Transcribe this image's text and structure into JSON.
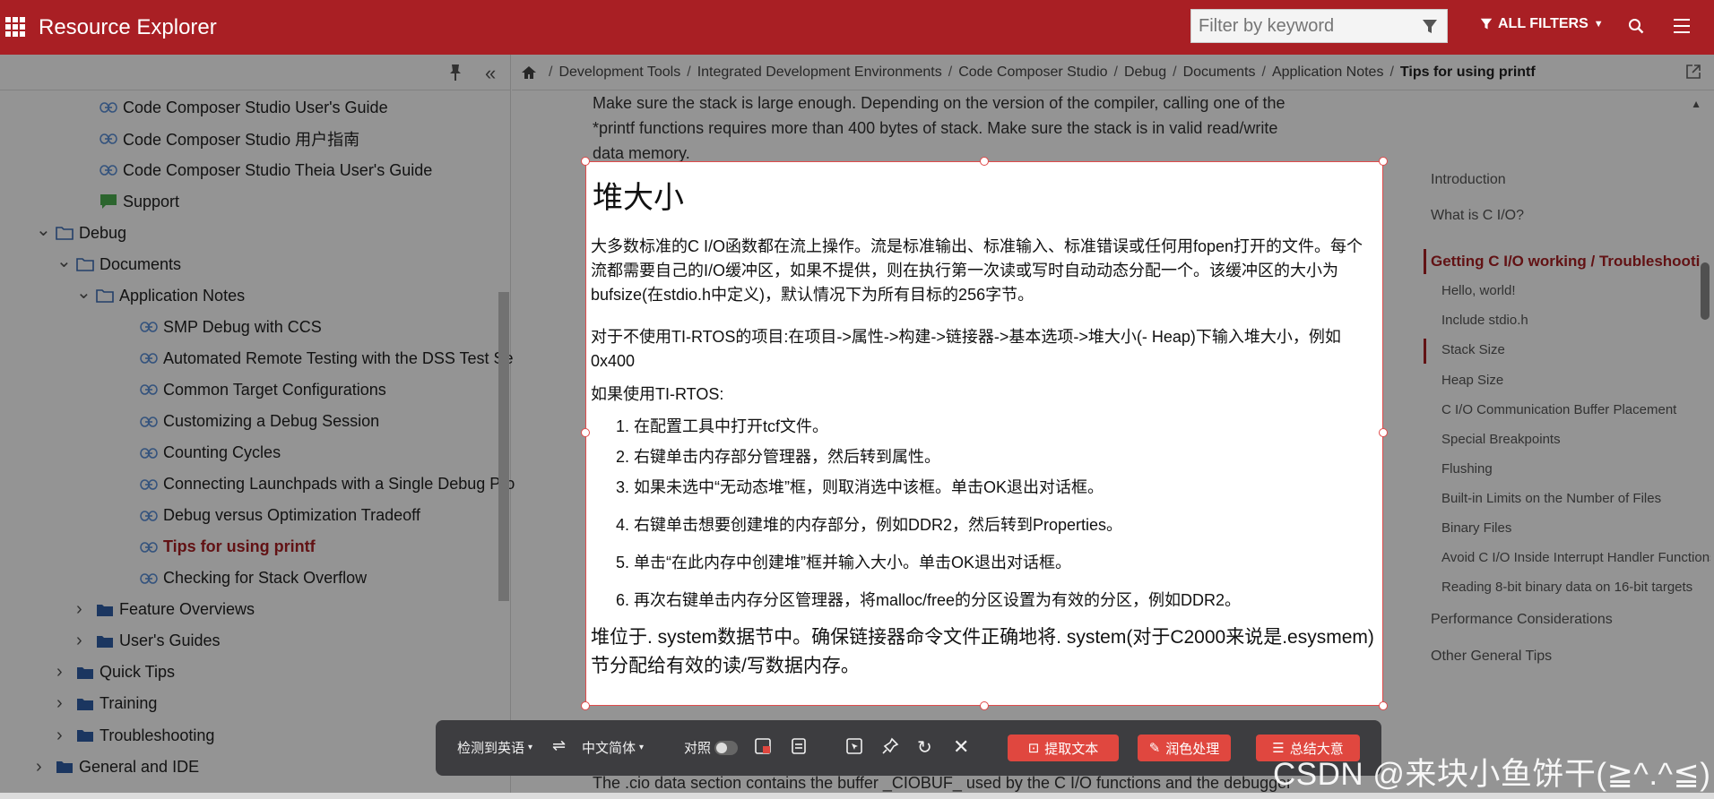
{
  "app": {
    "title": "Resource Explorer",
    "filter_placeholder": "Filter by keyword",
    "all_filters_label": "ALL FILTERS",
    "brand_color": "#a91f24"
  },
  "sidebar": {
    "items": [
      {
        "label": "Code Composer Studio User's Guide",
        "icon": "link-icon",
        "depth": 2
      },
      {
        "label": "Code Composer Studio 用户指南",
        "icon": "link-icon",
        "depth": 2
      },
      {
        "label": "Code Composer Studio Theia User's Guide",
        "icon": "link-icon",
        "depth": 2
      },
      {
        "label": "Support",
        "icon": "chat-icon",
        "depth": 2
      },
      {
        "label": "Debug",
        "icon": "folder-open-icon",
        "depth": 1,
        "expanded": true
      },
      {
        "label": "Documents",
        "icon": "folder-open-icon",
        "depth": 2,
        "expanded": true
      },
      {
        "label": "Application Notes",
        "icon": "folder-open-icon",
        "depth": 3,
        "expanded": true
      },
      {
        "label": "SMP Debug with CCS",
        "icon": "link-icon",
        "depth": 4
      },
      {
        "label": "Automated Remote Testing with the DSS Test Se",
        "icon": "link-icon",
        "depth": 4
      },
      {
        "label": "Common Target Configurations",
        "icon": "link-icon",
        "depth": 4
      },
      {
        "label": "Customizing a Debug Session",
        "icon": "link-icon",
        "depth": 4
      },
      {
        "label": "Counting Cycles",
        "icon": "link-icon",
        "depth": 4
      },
      {
        "label": "Connecting Launchpads with a Single Debug Pro",
        "icon": "link-icon",
        "depth": 4
      },
      {
        "label": "Debug versus Optimization Tradeoff",
        "icon": "link-icon",
        "depth": 4
      },
      {
        "label": "Tips for using printf",
        "icon": "link-icon",
        "depth": 4,
        "active": true
      },
      {
        "label": "Checking for Stack Overflow",
        "icon": "link-icon",
        "depth": 4
      },
      {
        "label": "Feature Overviews",
        "icon": "folder-icon",
        "depth": 3,
        "expanded": false
      },
      {
        "label": "User's Guides",
        "icon": "folder-icon",
        "depth": 3,
        "expanded": false
      },
      {
        "label": "Quick Tips",
        "icon": "folder-icon",
        "depth": 2,
        "expanded": false
      },
      {
        "label": "Training",
        "icon": "folder-icon",
        "depth": 2,
        "expanded": false
      },
      {
        "label": "Troubleshooting",
        "icon": "folder-icon",
        "depth": 2,
        "expanded": false
      },
      {
        "label": "General and IDE",
        "icon": "folder-icon",
        "depth": 1,
        "expanded": false
      }
    ]
  },
  "breadcrumb": {
    "items": [
      "Development Tools",
      "Integrated Development Environments",
      "Code Composer Studio",
      "Debug",
      "Documents",
      "Application Notes"
    ],
    "current": "Tips for using printf"
  },
  "content": {
    "paragraph": "Make sure the stack is large enough. Depending on the version of the compiler, calling one of the *printf functions requires more than 400 bytes of stack. Make sure the stack is in valid read/write data memory.",
    "bottom_text": "The .cio data section contains the buffer _CIOBUF_ used by the C I/O functions and the debugger to"
  },
  "toc": {
    "items": [
      {
        "label": "Introduction",
        "level": 1
      },
      {
        "label": "What is C I/O?",
        "level": 1
      },
      {
        "label": "Getting C I/O working / Troubleshooting",
        "level": 1,
        "active": true
      },
      {
        "label": "Hello, world!",
        "level": 2
      },
      {
        "label": "Include stdio.h",
        "level": 2
      },
      {
        "label": "Stack Size",
        "level": 2,
        "current": true
      },
      {
        "label": "Heap Size",
        "level": 2
      },
      {
        "label": "C I/O Communication Buffer Placement",
        "level": 2
      },
      {
        "label": "Special Breakpoints",
        "level": 2
      },
      {
        "label": "Flushing",
        "level": 2
      },
      {
        "label": "Built-in Limits on the Number of Files",
        "level": 2
      },
      {
        "label": "Binary Files",
        "level": 2
      },
      {
        "label": "Avoid C I/O Inside Interrupt Handler Functions",
        "level": 2
      },
      {
        "label": "Reading 8-bit binary data on 16-bit targets",
        "level": 2
      },
      {
        "label": "Performance Considerations",
        "level": 1
      },
      {
        "label": "Other General Tips",
        "level": 1
      }
    ]
  },
  "translation": {
    "title": "堆大小",
    "p1": "大多数标准的C I/O函数都在流上操作。流是标准输出、标准输入、标准错误或任何用fopen打开的文件。每个流都需要自己的I/O缓冲区，如果不提供，则在执行第一次读或写时自动动态分配一个。该缓冲区的大小为bufsize(在stdio.h中定义)，默认情况下为所有目标的256字节。",
    "p2": "对于不使用TI-RTOS的项目:在项目->属性->构建->链接器->基本选项->堆大小(- Heap)下输入堆大小，例如0x400",
    "p3": "如果使用TI-RTOS:",
    "steps": [
      "在配置工具中打开tcf文件。",
      "右键单击内存部分管理器，然后转到属性。",
      "如果未选中“无动态堆”框，则取消选中该框。单击OK退出对话框。",
      "右键单击想要创建堆的内存部分，例如DDR2，然后转到Properties。",
      "单击“在此内存中创建堆”框并输入大小。单击OK退出对话框。",
      "再次右键单击内存分区管理器，将malloc/free的分区设置为有效的分区，例如DDR2。"
    ],
    "p4": "堆位于. system数据节中。确保链接器命令文件正确地将. system(对于C2000来说是.esysmem)节分配给有效的读/写数据内存。"
  },
  "toolbar": {
    "source_lang": "检测到英语",
    "target_lang": "中文简体",
    "compare_label": "对照",
    "extract_label": "提取文本",
    "polish_label": "润色处理",
    "summary_label": "总结大意",
    "accent_color": "#e0473f"
  },
  "watermark": "CSDN @来块小鱼饼干(≧^.^≦)"
}
